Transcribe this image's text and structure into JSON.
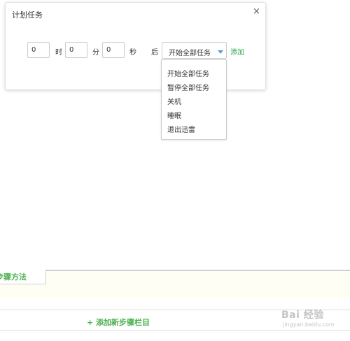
{
  "dialog": {
    "title": "计划任务",
    "close_label": "×",
    "hours_value": "0",
    "hours_unit": "时",
    "minutes_value": "0",
    "minutes_unit": "分",
    "seconds_value": "0",
    "seconds_unit": "秒",
    "after_label": "后",
    "action_selected": "开始全部任务",
    "add_label": "添加"
  },
  "dropdown": {
    "options": [
      "开始全部任务",
      "暂停全部任务",
      "关机",
      "睡眠",
      "退出迅雷"
    ]
  },
  "page": {
    "steps_tab_label": "步骤方法",
    "add_step_label": "+ 添加新步骤栏目",
    "watermark_text": "Bai 经验",
    "watermark_url": "jingyan.baidu.com"
  },
  "colors": {
    "accent_green": "#28a745",
    "chevron_blue": "#5b9bd5"
  }
}
